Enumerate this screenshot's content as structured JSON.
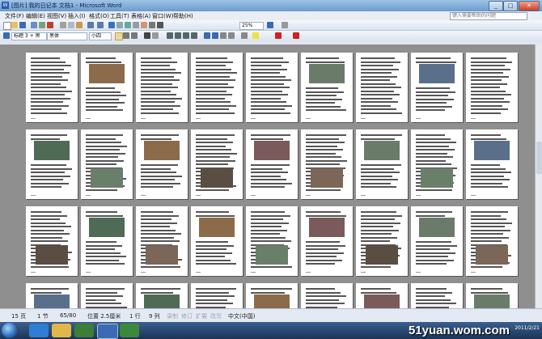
{
  "window": {
    "title": "[图片] 我的日记本 文档1 - Microsoft Word",
    "icon": "word-icon"
  },
  "menu": {
    "items": [
      "文件(F)",
      "编辑(E)",
      "视图(V)",
      "插入(I)",
      "格式(O)",
      "工具(T)",
      "表格(A)",
      "窗口(W)",
      "帮助(H)"
    ],
    "help_placeholder": "键入需要帮助的问题"
  },
  "toolbar": {
    "zoom": "25%",
    "style": "标题 3 + 黑",
    "font": "黑体",
    "size": "小四"
  },
  "status": {
    "page": "15 页",
    "section": "1 节",
    "page_of": "65/80",
    "position": "位置 2.5厘米",
    "line": "1 行",
    "column": "9 列",
    "rec": "录制",
    "trk": "修订",
    "ext": "扩展",
    "ovr": "改写",
    "lang": "中文(中国)"
  },
  "taskbar": {
    "watermark": "51yuan.wom.com",
    "clock_time": "",
    "clock_date": "2011/2/21"
  },
  "colors": {
    "title": "#6a9bd1",
    "workspace": "#8f8f8f",
    "taskbar": "#1b3456"
  }
}
